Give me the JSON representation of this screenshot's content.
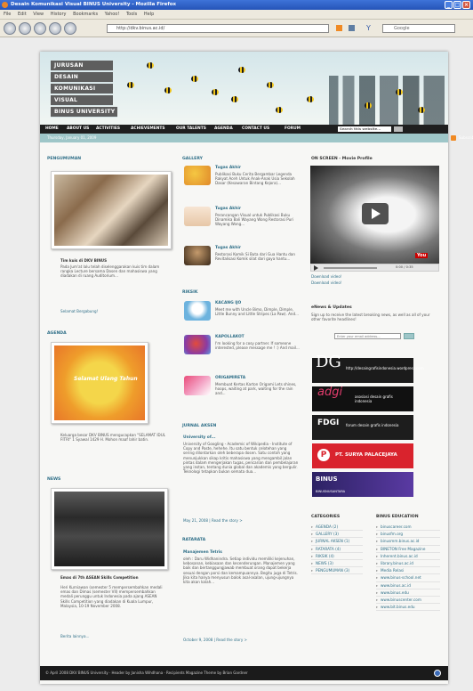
{
  "browser": {
    "title": "Desain Komunikasi Visual BINUS University - Mozilla Firefox",
    "menu": [
      "File",
      "Edit",
      "View",
      "History",
      "Bookmarks",
      "Yahoo!",
      "Tools",
      "Help"
    ],
    "url": "http://dkv.binus.ac.id/",
    "search_placeholder": "Google"
  },
  "site": {
    "logo_lines": [
      "JURUSAN",
      "DESAIN",
      "KOMUNIKASI",
      "VISUAL",
      "BINUS UNIVERSITY"
    ],
    "nav": [
      "HOME",
      "ABOUT US",
      "ACTIVITIES",
      "ACHIEVEMENTS",
      "OUR TALENTS",
      "AGENDA",
      "CONTACT US",
      "FORUM"
    ],
    "nav_search_placeholder": "Search this website...",
    "date": "Thursday, January 01, 2009",
    "rss_label": "Subscribe"
  },
  "left": {
    "pengumuman": {
      "heading": "PENGUMUMAN",
      "title": "Tim kuis di DKV BINUS",
      "body": "Pada Jum'at lalu telah diselenggarakan kuis tim dalam rangka Lecture bersama Dosen dan mahasiswa yang diadakan di ruang Auditorium...",
      "link": "Selamat Bergabung!"
    },
    "agenda": {
      "heading": "AGENDA",
      "poster_text": "Selamat Ulang Tahun",
      "body": "Keluarga besar DKV BINUS mengucapkan \"SELAMAT IDUL FITRI\" 1 Syawal 1429 H. Mohon maaf lahir batin."
    },
    "news": {
      "heading": "NEWS",
      "title": "Emas di 7th ASEAN Skills Competition",
      "body": "Heri Kurniawan (semester 5 mempersembahkan medali emas dan Dimas (semester VII) mempersembahkan medali perunggu untuk Indonesia pada ajang ASEAN Skills Competition yang diadakan di Kuala Lumpur, Malaysia, 10-19 November 2008.",
      "link": "Berita lainnya..."
    }
  },
  "middle": {
    "gallery": {
      "heading": "GALLERY",
      "items": [
        {
          "title": "Tugas Akhir",
          "text": "Publikasi Buku Cerita Bergambar Legenda Rakyat Aceh Untuk Anak-Anak Usia Sekolah Dasar (Kesawaran Bintang Kejora)..."
        },
        {
          "title": "Tugas Akhir",
          "text": "Perancangan Visual untuk Publikasi Buku Dinamika Bali Wayang Wong Restorasi Puri Wayang Wong..."
        },
        {
          "title": "Tugas Akhir",
          "text": "Restorasi Komik Si Buta dari Gua Hantu dan Revitalisasi Komik silat dari gaya hantu..."
        }
      ]
    },
    "riksik": {
      "heading": "RIKSIK",
      "items": [
        {
          "title": "KACANG IJO",
          "text": "Meet me with Uncle Bimo, Dimple, Dimple, Little Bunny and Little Stripes (La Paw). And..."
        },
        {
          "title": "KAPOLLAKOT",
          "text": "I'm looking for a cosy partner. If someone interested, please message me ! :) And mail..."
        },
        {
          "title": "ORIGAMIRETA",
          "text": "Membuat Kertas Karton Origami Lets shines, hoops, waiting at park, waiting for the rain and..."
        }
      ]
    },
    "jurnal": {
      "heading": "JURNAL AKSEN",
      "title": "University of...",
      "text": "University of Googling - Academic of Wikipedia - Institute of Copy and Paste, hehehe. Itu satu bentuk celotehan yang sering dilontarkan oleh beberapa dosen. Satu contoh yang menunjukkan sikap kritis mahasiswa yang mengambil jalan pintas dalam mengerjakan tugas, pencarian dan pembelajaran yang instan, tentang dunia global dan akademis yang bergulir. Teknologi tetapkan bukan semata dua...",
      "meta": "May 21, 2008 | Read the story >"
    },
    "ratarata": {
      "heading": "RATARATA",
      "title": "Manajemen Tetris",
      "text": "oleh : Daru Widhanindra. Setiap individu memiliki kejenuhan, kebosanan, kebiasaan dan kecenderungan. Manajemen yang baik dan bertanggungjawab membuat orang dapat bekerja sesuai dengan porsi dan kemampuannya. Begitu juga di Tetris. Jika kita hanya menyusun balok asal-asalan, ujung-ujungnya kita akan kalah...",
      "meta": "October 9, 2008 | Read the story >"
    }
  },
  "right": {
    "video": {
      "heading": "ON SCREEN - Movie Profile",
      "time": "0:00 / 0:35",
      "links": [
        "Download video!",
        "Download video!"
      ]
    },
    "enews": {
      "heading": "eNews & Updates",
      "text": "Sign up to receive the latest breaking news, as well as all of your other favorite headlines!",
      "placeholder": "Enter your email address..."
    },
    "banners": [
      {
        "big": "DG",
        "text": "http://desaingrafisindonesia.wordpress.com"
      },
      {
        "big": "adgi",
        "text": "asosiasi desain grafis indonesia"
      },
      {
        "big": "FDGI",
        "text": "forum desain grafis indonesia"
      },
      {
        "big": "P",
        "text": "PT. SURYA PALACEJAYA"
      },
      {
        "big": "BINUS",
        "text": "BINUSNUSANTARA"
      }
    ],
    "categories": {
      "heading": "CATEGORIES",
      "items": [
        "AGENDA (2)",
        "GALLERY (3)",
        "JURNAL AKSEN (1)",
        "RATARATA (4)",
        "RIKSIK (4)",
        "NEWS (3)",
        "PENGUMUMAN (3)"
      ]
    },
    "binus": {
      "heading": "BINUS EDUCATION",
      "items": [
        "binuscareer.com",
        "binusfm.org",
        "binusmm.binus.ac.id",
        "BINETON Free Magazine",
        "Inherent.binus.ac.id",
        "library.binus.ac.id",
        "Media Relasi",
        "www.binus-school.net",
        "www.binus.ac.id",
        "www.binus.edu",
        "www.binuscenter.com",
        "www.bit.binus.edu"
      ]
    }
  },
  "footer": "© April 2008 DKV BINUS University · Header by Janisha Wihdhana · Recipients Magazine Theme by Brian Gardner"
}
